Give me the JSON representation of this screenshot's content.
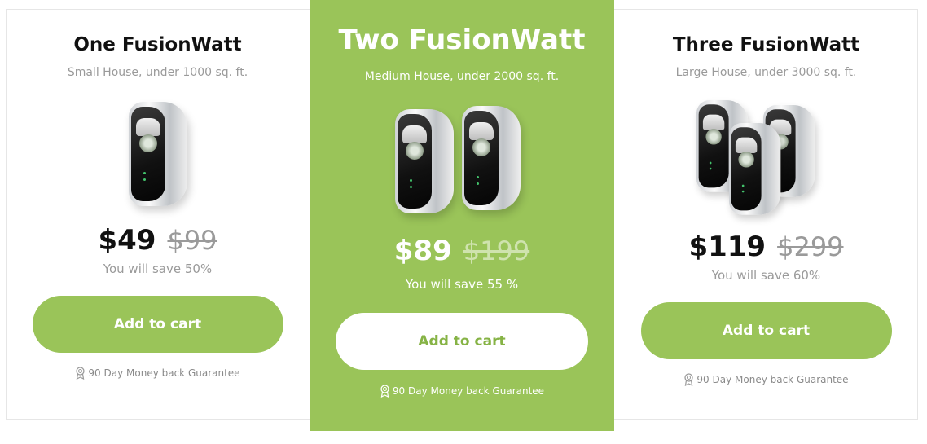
{
  "plans": [
    {
      "title": "One FusionWatt",
      "subtitle": "Small House, under 1000 sq. ft.",
      "product_image": "single-fusionwatt-device",
      "price": "$49",
      "old_price": "$99",
      "savings": "You will save 50%",
      "button_label": "Add to cart",
      "guarantee": "90 Day Money back Guarantee",
      "guarantee_icon": "award-icon"
    },
    {
      "title": "Two FusionWatt",
      "subtitle": "Medium House, under 2000 sq. ft.",
      "product_image": "two-fusionwatt-devices",
      "price": "$89",
      "old_price": "$199",
      "savings": "You will save 55 %",
      "button_label": "Add to cart",
      "guarantee": "90 Day Money back Guarantee",
      "guarantee_icon": "award-icon",
      "highlighted": true
    },
    {
      "title": "Three FusionWatt",
      "subtitle": "Large House, under 3000 sq. ft.",
      "product_image": "three-fusionwatt-devices",
      "price": "$119",
      "old_price": "$299",
      "savings": "You will save 60%",
      "button_label": "Add to cart",
      "guarantee": "90 Day Money back Guarantee",
      "guarantee_icon": "award-icon"
    }
  ],
  "colors": {
    "accent_green": "#9ac459",
    "button_text_green": "#86b345",
    "muted_text": "#9a9a9a",
    "price_text": "#111111"
  }
}
